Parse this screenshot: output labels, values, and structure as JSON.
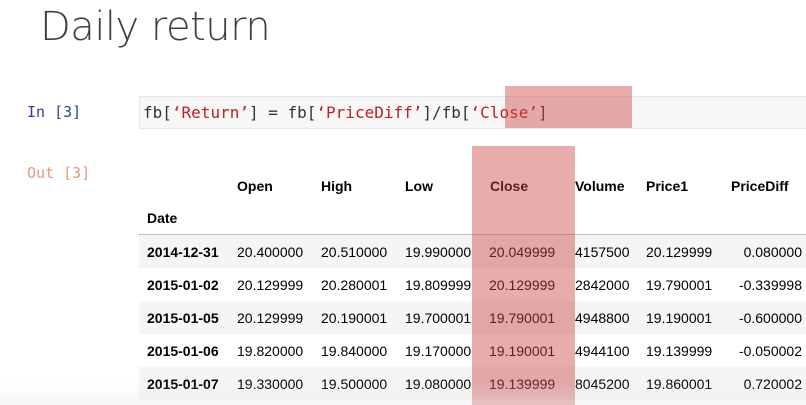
{
  "slide": {
    "title": "Daily return"
  },
  "input_cell": {
    "prompt": "In [3]",
    "code": {
      "p1": "fb[",
      "s1": "‘Return’",
      "p2": "] = fb[",
      "s2": "‘PriceDiff’",
      "p3": "]/fb[",
      "s3": "‘Close’",
      "p4": "]"
    }
  },
  "output_cell": {
    "prompt": "Out [3]",
    "table": {
      "columns": [
        "Open",
        "High",
        "Low",
        "Close",
        "Volume",
        "Price1",
        "PriceDiff"
      ],
      "index_name": "Date",
      "rows": [
        {
          "date": "2014-12-31",
          "open": "20.400000",
          "high": "20.510000",
          "low": "19.990000",
          "close": "20.049999",
          "volume": "4157500",
          "price1": "20.129999",
          "pricediff": "0.080000"
        },
        {
          "date": "2015-01-02",
          "open": "20.129999",
          "high": "20.280001",
          "low": "19.809999",
          "close": "20.129999",
          "volume": "2842000",
          "price1": "19.790001",
          "pricediff": "-0.339998"
        },
        {
          "date": "2015-01-05",
          "open": "20.129999",
          "high": "20.190001",
          "low": "19.700001",
          "close": "19.790001",
          "volume": "4948800",
          "price1": "19.190001",
          "pricediff": "-0.600000"
        },
        {
          "date": "2015-01-06",
          "open": "19.820000",
          "high": "19.840000",
          "low": "19.170000",
          "close": "19.190001",
          "volume": "4944100",
          "price1": "19.139999",
          "pricediff": "-0.050002"
        },
        {
          "date": "2015-01-07",
          "open": "19.330000",
          "high": "19.500000",
          "low": "19.080000",
          "close": "19.139999",
          "volume": "8045200",
          "price1": "19.860001",
          "pricediff": "0.720002"
        }
      ]
    }
  },
  "colors": {
    "highlight": "#cd4646",
    "string_literal": "#ba2121",
    "in_prompt": "#303f9f",
    "out_prompt": "#d84315"
  }
}
